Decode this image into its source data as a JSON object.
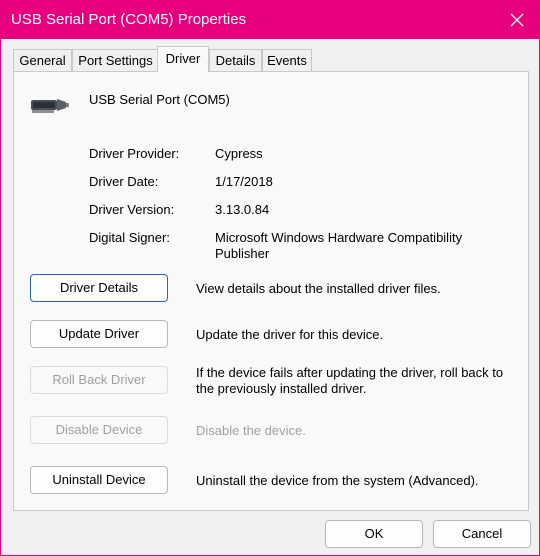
{
  "window": {
    "title": "USB Serial Port (COM5) Properties",
    "accent_color": "#e6007e"
  },
  "tabs": [
    {
      "label": "General"
    },
    {
      "label": "Port Settings"
    },
    {
      "label": "Driver",
      "active": true
    },
    {
      "label": "Details"
    },
    {
      "label": "Events"
    }
  ],
  "device": {
    "name": "USB Serial Port (COM5)",
    "icon": "serial-port-connector-icon"
  },
  "driver_info": {
    "provider_label": "Driver Provider:",
    "provider_value": "Cypress",
    "date_label": "Driver Date:",
    "date_value": "1/17/2018",
    "version_label": "Driver Version:",
    "version_value": "3.13.0.84",
    "signer_label": "Digital Signer:",
    "signer_value": "Microsoft Windows Hardware Compatibility Publisher"
  },
  "actions": {
    "details_label": "Driver Details",
    "details_desc": "View details about the installed driver files.",
    "update_label": "Update Driver",
    "update_desc": "Update the driver for this device.",
    "rollback_label": "Roll Back Driver",
    "rollback_desc": "If the device fails after updating the driver, roll back to the previously installed driver.",
    "disable_label": "Disable Device",
    "disable_desc": "Disable the device.",
    "uninstall_label": "Uninstall Device",
    "uninstall_desc": "Uninstall the device from the system (Advanced)."
  },
  "footer": {
    "ok_label": "OK",
    "cancel_label": "Cancel"
  }
}
